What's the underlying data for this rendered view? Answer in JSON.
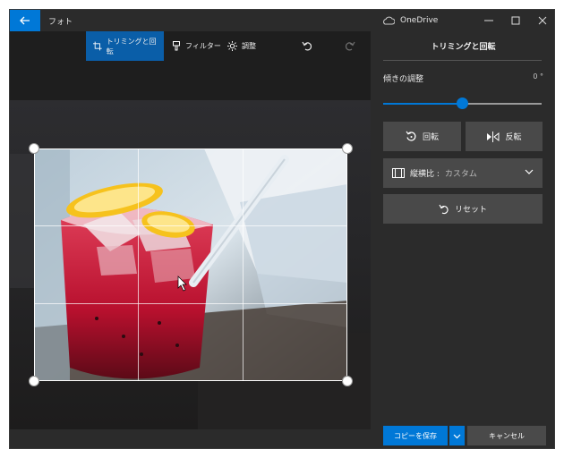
{
  "window": {
    "app_title": "フォト",
    "onedrive_label": "OneDrive"
  },
  "toolbar": {
    "crop_rotate": "トリミングと回転",
    "filters": "フィルター",
    "adjust": "調整"
  },
  "panel": {
    "title": "トリミングと回転",
    "tilt_label": "傾きの調整",
    "tilt_value": "0 °",
    "tilt_slider_fraction": 0.5,
    "rotate_label": "回転",
    "flip_label": "反転",
    "aspect_label": "縦横比 :",
    "aspect_value": "カスタム",
    "reset_label": "リセット",
    "save_copy_label": "コピーを保存",
    "cancel_label": "キャンセル"
  },
  "colors": {
    "accent": "#0078d7",
    "panel_bg": "#2b2b2b",
    "button_bg": "#494949"
  },
  "icons": [
    "back-arrow-icon",
    "onedrive-icon",
    "minimize-icon",
    "maximize-icon",
    "close-icon",
    "crop-icon",
    "filter-icon",
    "adjust-icon",
    "undo-icon",
    "redo-icon",
    "rotate-icon",
    "flip-icon",
    "aspect-ratio-icon",
    "chevron-down-icon",
    "reset-icon"
  ]
}
